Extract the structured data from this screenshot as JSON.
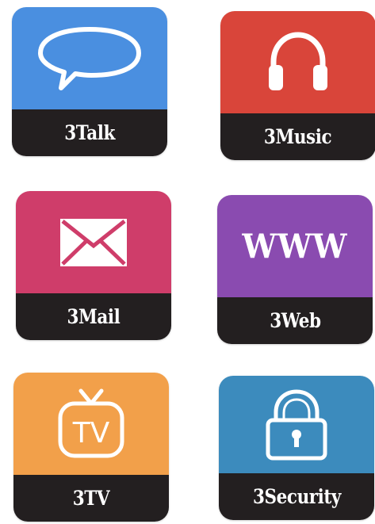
{
  "tiles": [
    {
      "id": "talk",
      "label": "3Talk",
      "icon": "speech-bubble-icon",
      "color": "#4a8fe0"
    },
    {
      "id": "music",
      "label": "3Music",
      "icon": "headphones-icon",
      "color": "#d9453a"
    },
    {
      "id": "mail",
      "label": "3Mail",
      "icon": "envelope-icon",
      "color": "#cf3d6a"
    },
    {
      "id": "web",
      "label": "3Web",
      "icon": "www-icon",
      "icon_text": "WWW",
      "color": "#8a4bb0"
    },
    {
      "id": "tv",
      "label": "3TV",
      "icon": "tv-icon",
      "icon_text": "TV",
      "color": "#f2a04a"
    },
    {
      "id": "security",
      "label": "3Security",
      "icon": "padlock-icon",
      "color": "#3c8bbd"
    }
  ],
  "colors": {
    "label_bar": "#231f20",
    "icon": "#ffffff",
    "background": "#ffffff"
  }
}
